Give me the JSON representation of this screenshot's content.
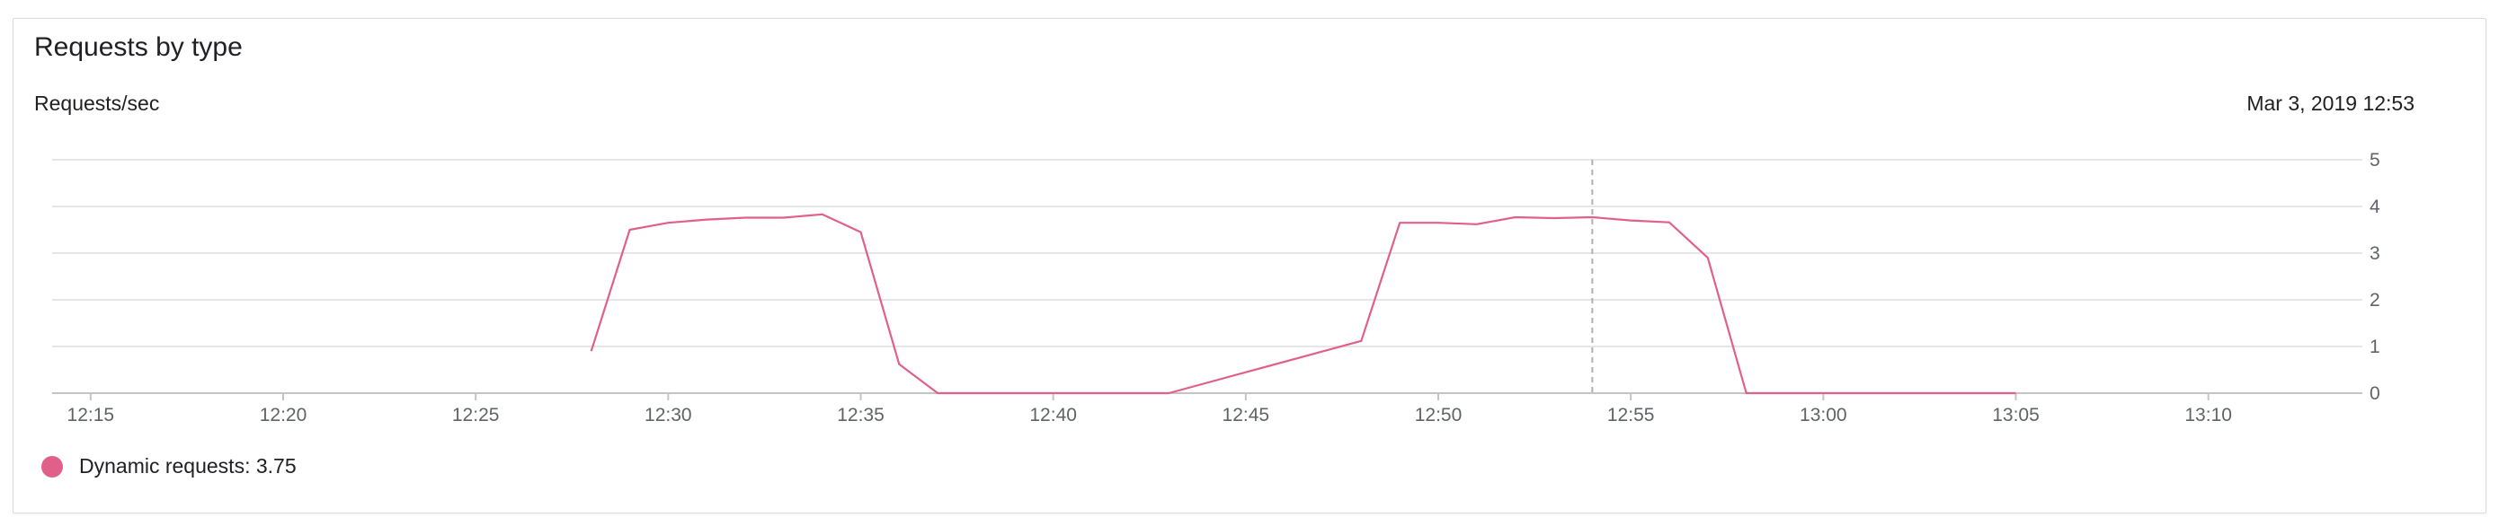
{
  "card": {
    "title": "Requests by type",
    "hover_time": "Mar 3, 2019 12:53"
  },
  "legend": {
    "label": "Dynamic requests:",
    "value": "3.75"
  },
  "colors": {
    "series": "#e0608a",
    "grid": "#e6e6e6",
    "cursor": "#b0b0b0",
    "tick_text": "#5f6368"
  },
  "chart_data": {
    "type": "line",
    "title": "Requests by type",
    "ylabel": "Requests/sec",
    "xlabel": "",
    "x_ticks": [
      "12:15",
      "12:20",
      "12:25",
      "12:30",
      "12:35",
      "12:40",
      "12:45",
      "12:50",
      "12:55",
      "13:00",
      "13:05",
      "13:10"
    ],
    "y_ticks": [
      0,
      1,
      2,
      3,
      4,
      5
    ],
    "ylim": [
      0,
      5
    ],
    "xlim": [
      "12:14",
      "13:14"
    ],
    "y_axis_side": "right",
    "grid": true,
    "legend_placement": "bottom-left",
    "hover_cursor_x": "12:54",
    "series": [
      {
        "name": "Dynamic requests",
        "x": [
          "12:28",
          "12:29",
          "12:30",
          "12:31",
          "12:32",
          "12:33",
          "12:34",
          "12:35",
          "12:36",
          "12:37",
          "12:38",
          "12:39",
          "12:40",
          "12:41",
          "12:42",
          "12:43",
          "12:48",
          "12:49",
          "12:50",
          "12:51",
          "12:52",
          "12:53",
          "12:54",
          "12:55",
          "12:56",
          "12:57",
          "12:58",
          "12:59",
          "13:00",
          "13:01",
          "13:02",
          "13:03",
          "13:04",
          "13:05"
        ],
        "values": [
          0.9,
          3.5,
          3.65,
          3.72,
          3.76,
          3.76,
          3.83,
          3.45,
          0.62,
          0,
          0,
          0,
          0,
          0,
          0,
          0,
          1.12,
          3.65,
          3.65,
          3.62,
          3.77,
          3.75,
          3.77,
          3.7,
          3.66,
          2.9,
          0,
          0,
          0,
          0,
          0,
          0,
          0,
          0
        ]
      }
    ]
  }
}
